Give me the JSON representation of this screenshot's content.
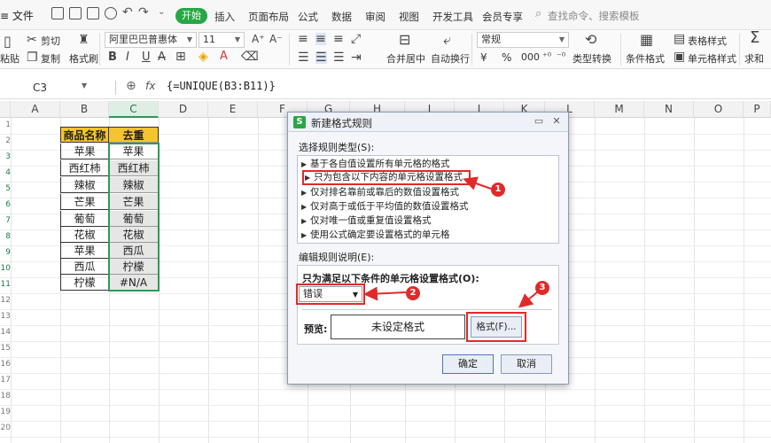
{
  "menubar": {
    "file": "≡ 文件",
    "start_tab": "开始",
    "tabs": [
      "插入",
      "页面布局",
      "公式",
      "数据",
      "审阅",
      "视图",
      "开发工具",
      "会员专享"
    ],
    "search": "查找命令、搜索模板"
  },
  "ribbon": {
    "paste": "粘贴",
    "cut": "剪切",
    "copy": "复制",
    "format_painter": "格式刷",
    "font_name": "阿里巴巴普惠体",
    "font_size": "11",
    "merge_center": "合并居中",
    "wrap_text": "自动换行",
    "number_format": "常规",
    "currency": "¥",
    "percent": "%",
    "thousands": "000",
    "type_convert": "类型转换",
    "conditional_format": "条件格式",
    "table_style": "表格样式",
    "cell_style": "单元格样式",
    "sum": "求和"
  },
  "formula_bar": {
    "name_box": "C3",
    "fx": "fx",
    "formula": "{=UNIQUE(B3:B11)}"
  },
  "columns": [
    "A",
    "B",
    "C",
    "D",
    "E",
    "F",
    "G",
    "H",
    "I",
    "J",
    "K",
    "L",
    "M",
    "N",
    "O",
    "P"
  ],
  "rows": [
    "1",
    "2",
    "3",
    "4",
    "5",
    "6",
    "7",
    "8",
    "9",
    "10",
    "11",
    "12",
    "13",
    "14",
    "15",
    "16",
    "17",
    "18",
    "19",
    "20",
    "21",
    "22"
  ],
  "table": {
    "header_b": "商品名称",
    "header_c": "去重",
    "col_b": [
      "苹果",
      "西红柿",
      "辣椒",
      "芒果",
      "葡萄",
      "花椒",
      "苹果",
      "西瓜",
      "柠檬"
    ],
    "col_c": [
      "苹果",
      "西红柿",
      "辣椒",
      "芒果",
      "葡萄",
      "花椒",
      "西瓜",
      "柠檬",
      "#N/A"
    ]
  },
  "dialog": {
    "title": "新建格式规则",
    "select_type_label": "选择规则类型(S):",
    "rules": [
      "基于各自值设置所有单元格的格式",
      "只为包含以下内容的单元格设置格式",
      "仅对排名靠前或靠后的数值设置格式",
      "仅对高于或低于平均值的数值设置格式",
      "仅对唯一值或重复值设置格式",
      "使用公式确定要设置格式的单元格"
    ],
    "edit_desc_label": "编辑规则说明(E):",
    "condition_label": "只为满足以下条件的单元格设置格式(O):",
    "condition_value": "错误",
    "preview_label": "预览:",
    "preview_text": "未设定格式",
    "format_button": "格式(F)...",
    "ok_button": "确定",
    "cancel_button": "取消"
  },
  "annotations": {
    "color": "#e02a2a",
    "badges": [
      "1",
      "2",
      "3"
    ]
  }
}
